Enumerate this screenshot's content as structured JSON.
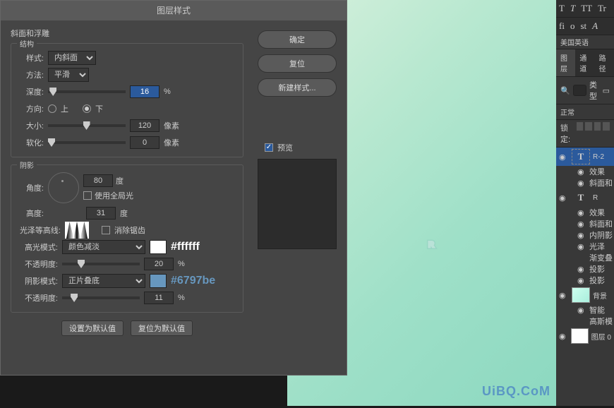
{
  "dialog": {
    "title": "图层样式",
    "section": "斜面和浮雕",
    "structure": {
      "label": "结构",
      "style_lab": "样式:",
      "style_val": "内斜面",
      "method_lab": "方法:",
      "method_val": "平滑",
      "depth_lab": "深度:",
      "depth_val": "16",
      "depth_unit": "%",
      "dir_lab": "方向:",
      "dir_up": "上",
      "dir_down": "下",
      "size_lab": "大小:",
      "size_val": "120",
      "size_unit": "像素",
      "soften_lab": "软化:",
      "soften_val": "0",
      "soften_unit": "像素"
    },
    "shading": {
      "label": "阴影",
      "angle_lab": "角度:",
      "angle_val": "80",
      "angle_unit": "度",
      "global_lab": "使用全局光",
      "alt_lab": "高度:",
      "alt_val": "31",
      "alt_unit": "度",
      "gloss_lab": "光泽等高线:",
      "antialias_lab": "消除锯齿",
      "hi_lab": "高光模式:",
      "hi_val": "颜色减淡",
      "hi_hex": "#ffffff",
      "hi_op_lab": "不透明度:",
      "hi_op_val": "20",
      "hi_op_unit": "%",
      "sh_lab": "阴影模式:",
      "sh_val": "正片叠底",
      "sh_hex": "#6797be",
      "sh_op_lab": "不透明度:",
      "sh_op_val": "11",
      "sh_op_unit": "%"
    },
    "defaults": {
      "set": "设置为默认值",
      "reset": "复位为默认值"
    },
    "buttons": {
      "ok": "确定",
      "cancel": "复位",
      "new": "新建样式..."
    },
    "preview": "预览"
  },
  "panels": {
    "lang": "美国英语",
    "tabs": {
      "layers": "图层",
      "channels": "通道",
      "paths": "路径"
    },
    "filter": "类型",
    "blend": "正常",
    "lock": "锁定:",
    "items": [
      {
        "name": "R-2",
        "sel": true,
        "type": "T",
        "fx": [
          "效果",
          "斜面和"
        ]
      },
      {
        "name": "R",
        "type": "T",
        "fx": [
          "效果",
          "斜面和",
          "内阴影",
          "光泽",
          "渐变叠",
          "投影",
          "投影"
        ]
      },
      {
        "name": "背景",
        "type": "bg",
        "fx": [
          "智能"
        ]
      },
      {
        "name": "高斯模",
        "type": "sub"
      },
      {
        "name": "图层 0",
        "type": "img"
      }
    ]
  },
  "watermark": "UiBQ.CoM"
}
